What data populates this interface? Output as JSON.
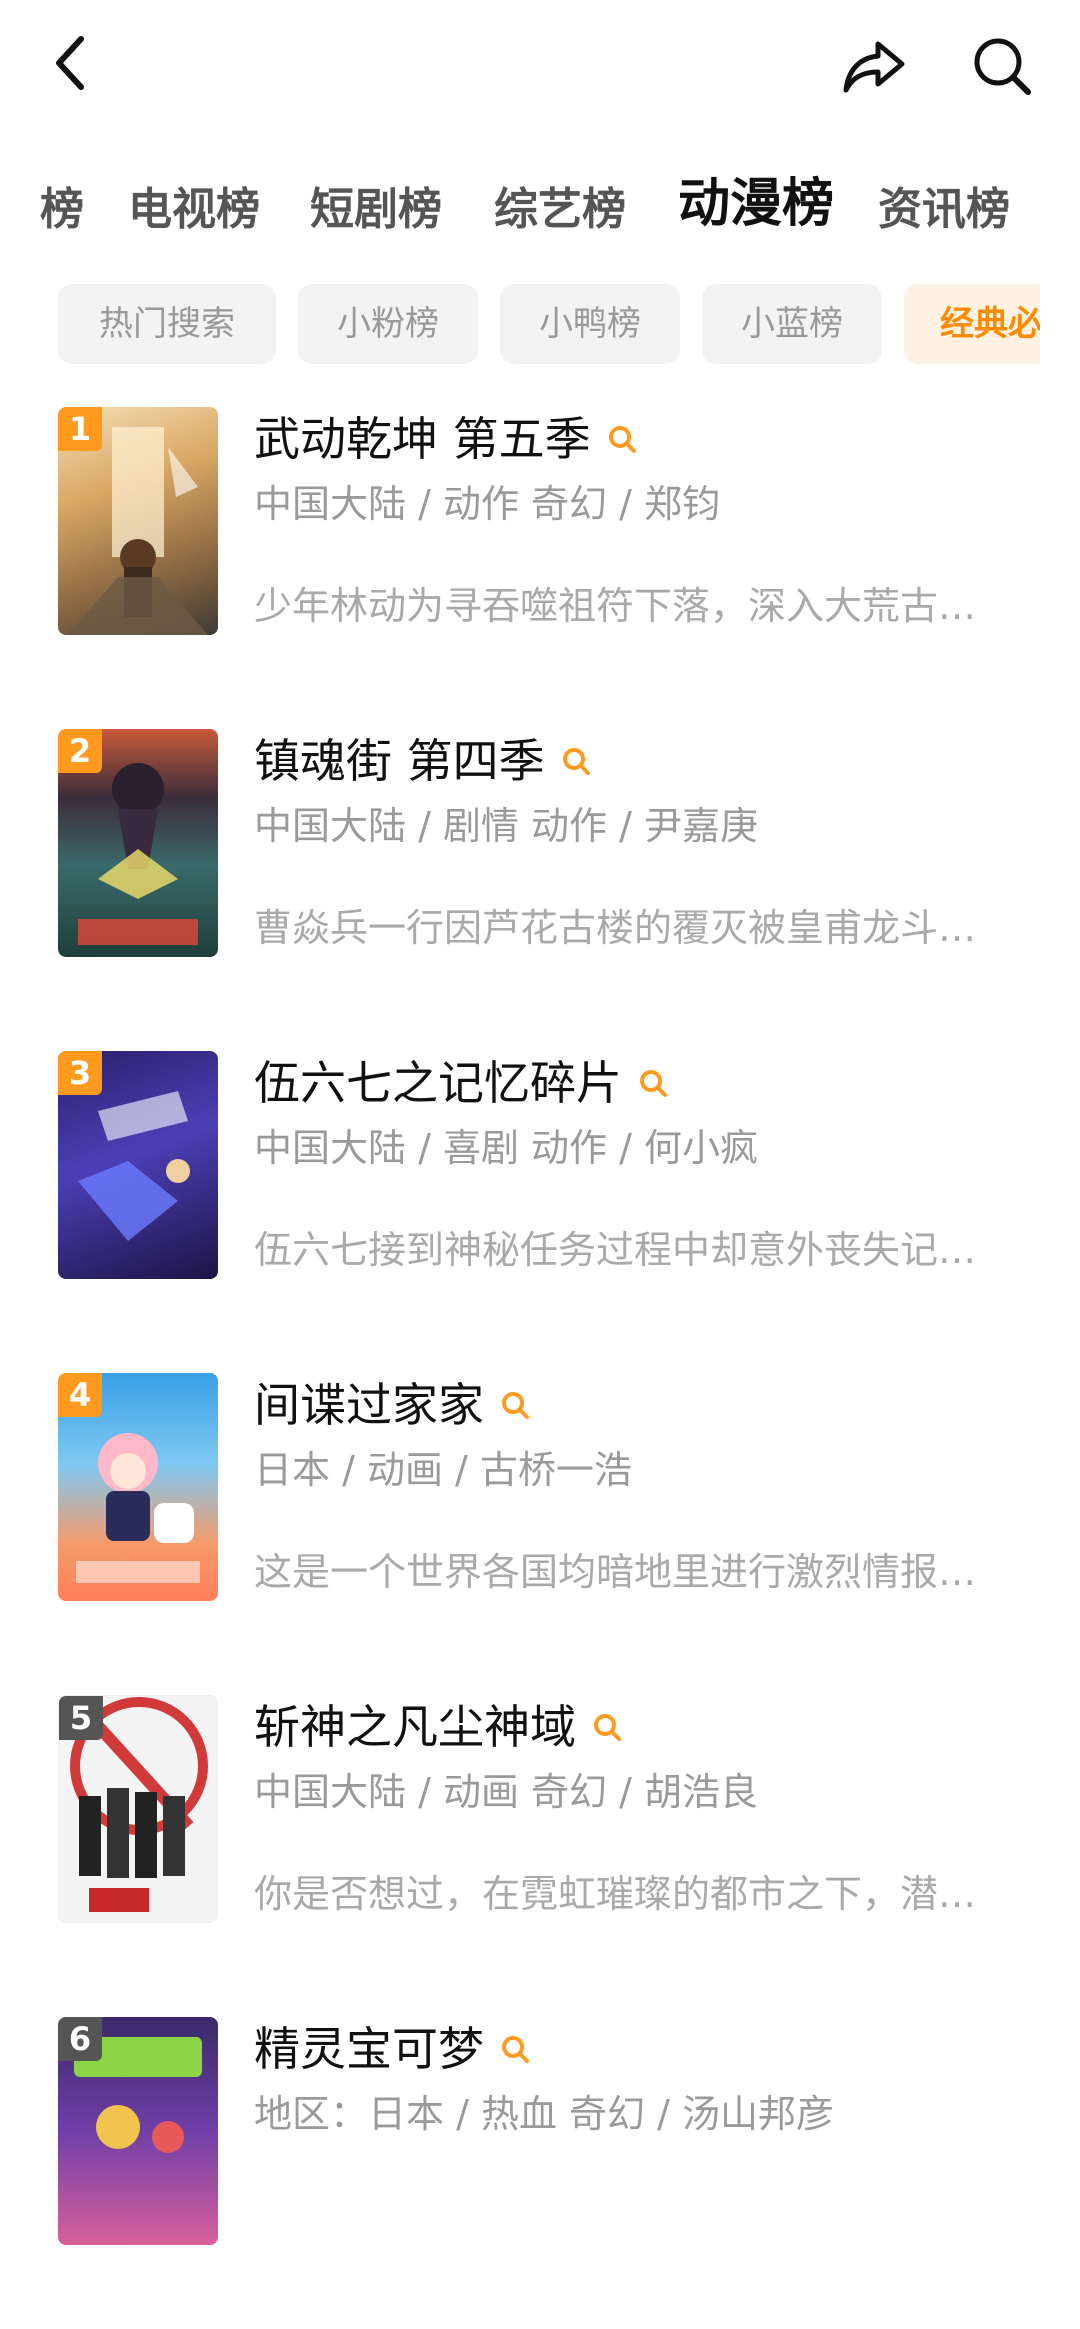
{
  "header": {
    "back_icon": "chevron-left-icon",
    "share_icon": "share-arrow-icon",
    "search_icon": "search-icon"
  },
  "tabs": [
    {
      "label": "榜"
    },
    {
      "label": "电视榜"
    },
    {
      "label": "短剧榜"
    },
    {
      "label": "综艺榜"
    },
    {
      "label": "动漫榜",
      "active": true
    },
    {
      "label": "资讯榜"
    }
  ],
  "chips": [
    {
      "label": "热门搜索"
    },
    {
      "label": "小粉榜"
    },
    {
      "label": "小鸭榜"
    },
    {
      "label": "小蓝榜"
    },
    {
      "label": "经典必",
      "active": true
    }
  ],
  "colors": {
    "accent": "#ff8a00",
    "rank_top": "#ff9a1f",
    "rank_other": "#555555"
  },
  "items": [
    {
      "rank": "1",
      "title": "武动乾坤 第五季",
      "meta": "中国大陆 / 动作 奇幻 / 郑钧",
      "desc": "少年林动为寻吞噬祖符下落，深入大荒古…"
    },
    {
      "rank": "2",
      "title": "镇魂街 第四季",
      "meta": "中国大陆 / 剧情 动作 / 尹嘉庚",
      "desc": "曹焱兵一行因芦花古楼的覆灭被皇甫龙斗…"
    },
    {
      "rank": "3",
      "title": "伍六七之记忆碎片",
      "meta": "中国大陆 / 喜剧 动作 / 何小疯",
      "desc": "伍六七接到神秘任务过程中却意外丧失记…"
    },
    {
      "rank": "4",
      "title": "间谍过家家",
      "meta": "日本 / 动画 / 古桥一浩",
      "desc": "这是一个世界各国均暗地里进行激烈情报…"
    },
    {
      "rank": "5",
      "title": "斩神之凡尘神域",
      "meta": "中国大陆 / 动画 奇幻 / 胡浩良",
      "desc": "你是否想过，在霓虹璀璨的都市之下，潜…"
    },
    {
      "rank": "6",
      "title": "精灵宝可梦",
      "meta": "地区：日本 / 热血 奇幻 / 汤山邦彦",
      "desc": ""
    }
  ]
}
